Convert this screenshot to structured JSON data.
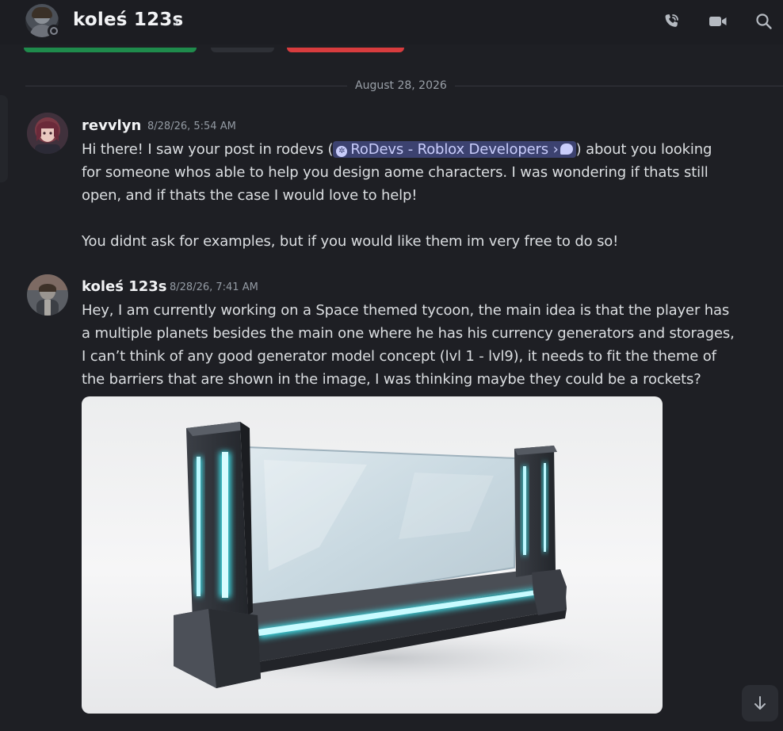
{
  "header": {
    "title": "koleś 123s",
    "chevron": "›",
    "icons": [
      "phone-icon",
      "video-icon",
      "search-icon"
    ]
  },
  "divider": {
    "date": "August 28, 2026"
  },
  "messages": [
    {
      "author": "revvlyn",
      "timestamp": "8/28/26, 5:54 AM",
      "lines": [
        {
          "before": "Hi there! I saw your post in rodevs (",
          "mention": "RoDevs - Roblox Developers",
          "mention_chevron": "›",
          "after": ") about you looking"
        },
        "for someone whos able to help you design aome characters. I was wondering if thats still",
        "open, and if thats the case I would love to help!",
        "You didnt ask for examples, but if you would like them im very free to do so!"
      ]
    },
    {
      "author": "koleś 123s",
      "timestamp": "8/28/26, 7:41 AM",
      "lines": [
        "Hey, I am currently working on a Space themed tycoon, the main idea is that the player has",
        "a multiple planets besides the main one where he has his currency generators and storages,",
        "I  can’t think of any good generator model concept (lvl 1 - lvl9), it needs to fit the theme of",
        "the barriers that are shown in the image, I was thinking maybe they could be a rockets?"
      ],
      "attachment": {
        "type": "image",
        "subject": "glass-barrier-with-cyan-lights"
      }
    }
  ],
  "scroll_button": {
    "icon": "arrow-down-icon",
    "glyph": "↓"
  },
  "colors": {
    "background": "#1e1f24",
    "header": "#1c1d22",
    "mention_bg": "#3c4270",
    "mention_text": "#c9cdfb",
    "neon": "#3fe6f0",
    "tag_green": "#1f8b4c",
    "tag_red": "#d83c3e"
  }
}
